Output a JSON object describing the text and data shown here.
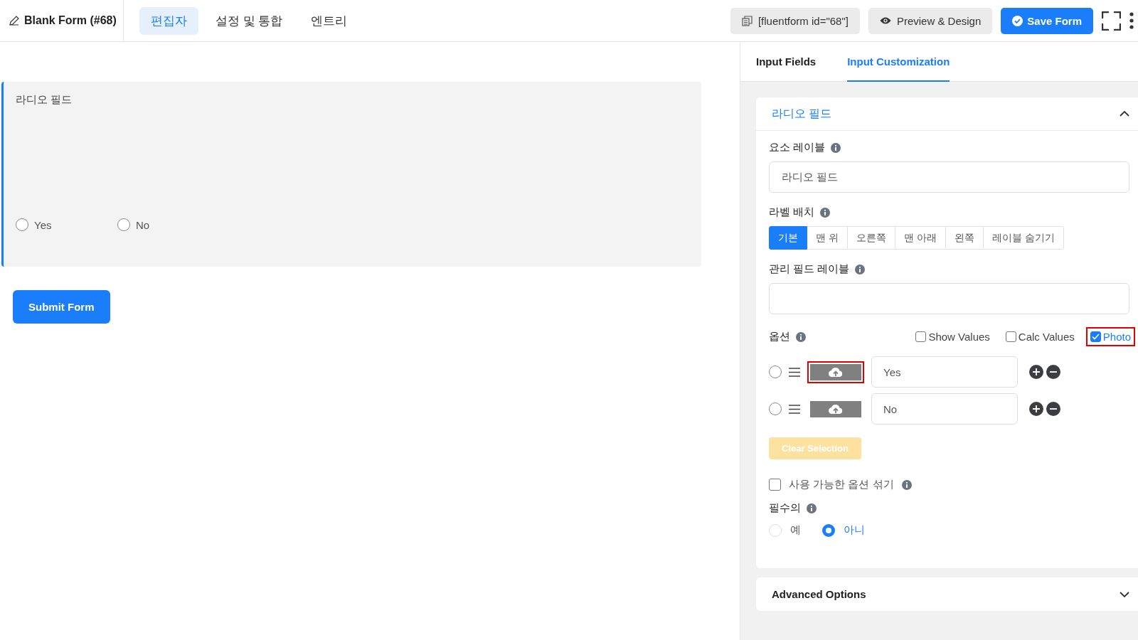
{
  "header": {
    "title": "Blank Form (#68)",
    "tabs": [
      {
        "label": "편집자",
        "selected": true
      },
      {
        "label": "설정 및 통합",
        "selected": false
      },
      {
        "label": "엔트리",
        "selected": false
      }
    ],
    "shortcode": "[fluentform id=\"68\"]",
    "preview": "Preview & Design",
    "save": "Save Form"
  },
  "canvas": {
    "field": {
      "label": "라디오 필드",
      "selected": true,
      "options": [
        {
          "label": "Yes",
          "checked": false
        },
        {
          "label": "No",
          "checked": false
        }
      ]
    },
    "submit": "Submit Form"
  },
  "panel": {
    "tabs": [
      {
        "label": "Input Fields",
        "selected": false
      },
      {
        "label": "Input Customization",
        "selected": true
      }
    ],
    "section": {
      "title": "라디오 필드",
      "expanded": true,
      "element_label": {
        "label": "요소 레이블",
        "value": "라디오 필드"
      },
      "label_placement": {
        "label": "라벨 배치",
        "options": [
          {
            "label": "기본",
            "selected": true
          },
          {
            "label": "맨 위",
            "selected": false
          },
          {
            "label": "오른쪽",
            "selected": false
          },
          {
            "label": "맨 아래",
            "selected": false
          },
          {
            "label": "왼쪽",
            "selected": false
          },
          {
            "label": "레이블 숨기기",
            "selected": false
          }
        ]
      },
      "admin_label": {
        "label": "관리 필드 레이블"
      },
      "options": {
        "label": "옵션",
        "toggles": [
          {
            "label": "Show Values",
            "checked": false,
            "highlighted": false
          },
          {
            "label": "Calc Values",
            "checked": false,
            "highlighted": false
          },
          {
            "label": "Photo",
            "checked": true,
            "highlighted": true
          }
        ],
        "items": [
          {
            "value": "Yes",
            "checked": false,
            "highlighted": true
          },
          {
            "value": "No",
            "checked": false,
            "highlighted": false
          }
        ]
      },
      "clear": {
        "label": "Clear Selection",
        "disabled": true
      },
      "shuffle": {
        "label": "사용 가능한 옵션 섞기",
        "checked": false
      },
      "required": {
        "label": "필수의",
        "options": [
          {
            "label": "예",
            "selected": false
          },
          {
            "label": "아니",
            "selected": true
          }
        ]
      }
    },
    "advanced": {
      "title": "Advanced Options",
      "expanded": false
    }
  }
}
